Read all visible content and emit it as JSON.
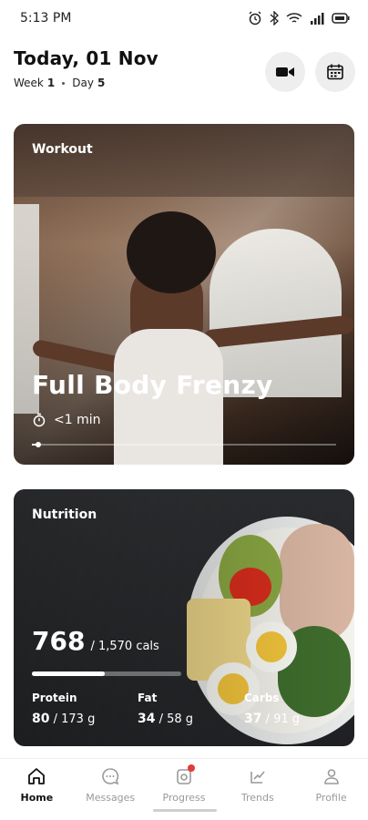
{
  "status_bar": {
    "time": "5:13 PM",
    "icons": [
      "alarm-icon",
      "bluetooth-icon",
      "wifi-icon",
      "signal-icon",
      "battery-icon"
    ]
  },
  "header": {
    "date_title": "Today, 01 Nov",
    "week_label": "Week",
    "week_value": "1",
    "day_label": "Day",
    "day_value": "5",
    "buttons": [
      "video-icon",
      "calendar-icon"
    ]
  },
  "workout": {
    "section_label": "Workout",
    "title": "Full Body Frenzy",
    "duration": "<1 min",
    "progress_fraction": 0.02
  },
  "nutrition": {
    "section_label": "Nutrition",
    "calories_consumed": "768",
    "calories_total": "/ 1,570 cals",
    "calories_fraction": 0.49,
    "macros": [
      {
        "label": "Protein",
        "value": "80",
        "target": "/ 173 g"
      },
      {
        "label": "Fat",
        "value": "34",
        "target": "/ 58 g"
      },
      {
        "label": "Carbs",
        "value": "37",
        "target": "/ 91 g"
      }
    ]
  },
  "tabbar": {
    "tabs": [
      {
        "label": "Home",
        "icon": "home-icon",
        "active": true
      },
      {
        "label": "Messages",
        "icon": "messages-icon",
        "active": false
      },
      {
        "label": "Progress",
        "icon": "progress-icon",
        "active": false,
        "badge": true
      },
      {
        "label": "Trends",
        "icon": "trends-icon",
        "active": false
      },
      {
        "label": "Profile",
        "icon": "profile-icon",
        "active": false
      }
    ]
  },
  "colors": {
    "accent": "#111111",
    "badge": "#e53935",
    "inactive_tab": "#9a9a9a"
  }
}
